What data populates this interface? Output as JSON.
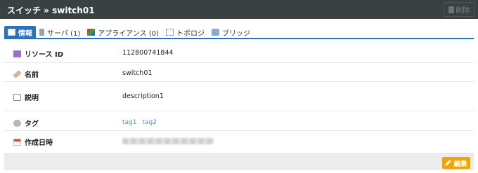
{
  "header": {
    "title": "スイッチ » switch01",
    "delete_label": "削除"
  },
  "tabs": [
    {
      "label": "情報",
      "icon": "info-icon"
    },
    {
      "label": "サーバ (1)",
      "icon": "server-icon"
    },
    {
      "label": "アプライアンス (0)",
      "icon": "appliance-icon"
    },
    {
      "label": "トポロジ",
      "icon": "topology-icon"
    },
    {
      "label": "ブリッジ",
      "icon": "bridge-icon"
    }
  ],
  "details": {
    "resource_id": {
      "label": "リソース ID",
      "value": "112800741844"
    },
    "name": {
      "label": "名前",
      "value": "switch01"
    },
    "description": {
      "label": "説明",
      "value": "description1"
    },
    "tags": {
      "label": "タグ",
      "values": [
        "tag1",
        "tag2"
      ]
    },
    "created": {
      "label": "作成日時"
    }
  },
  "footer": {
    "edit_label": "編集"
  }
}
